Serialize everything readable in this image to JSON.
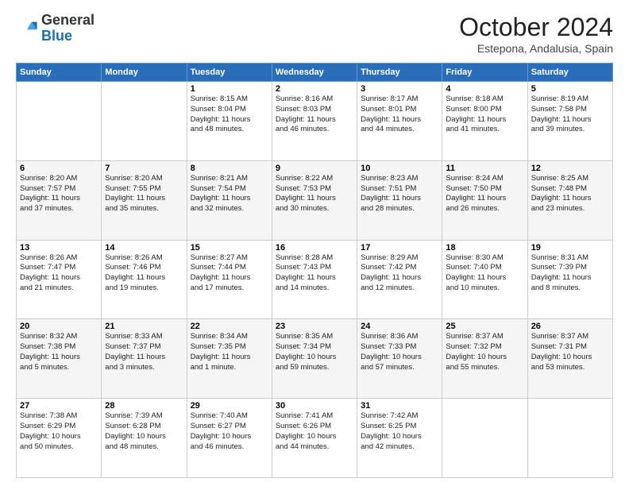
{
  "header": {
    "logo_general": "General",
    "logo_blue": "Blue",
    "month_title": "October 2024",
    "subtitle": "Estepona, Andalusia, Spain"
  },
  "days_of_week": [
    "Sunday",
    "Monday",
    "Tuesday",
    "Wednesday",
    "Thursday",
    "Friday",
    "Saturday"
  ],
  "weeks": [
    [
      {
        "day": "",
        "detail": ""
      },
      {
        "day": "",
        "detail": ""
      },
      {
        "day": "1",
        "detail": "Sunrise: 8:15 AM\nSunset: 8:04 PM\nDaylight: 11 hours\nand 48 minutes."
      },
      {
        "day": "2",
        "detail": "Sunrise: 8:16 AM\nSunset: 8:03 PM\nDaylight: 11 hours\nand 46 minutes."
      },
      {
        "day": "3",
        "detail": "Sunrise: 8:17 AM\nSunset: 8:01 PM\nDaylight: 11 hours\nand 44 minutes."
      },
      {
        "day": "4",
        "detail": "Sunrise: 8:18 AM\nSunset: 8:00 PM\nDaylight: 11 hours\nand 41 minutes."
      },
      {
        "day": "5",
        "detail": "Sunrise: 8:19 AM\nSunset: 7:58 PM\nDaylight: 11 hours\nand 39 minutes."
      }
    ],
    [
      {
        "day": "6",
        "detail": "Sunrise: 8:20 AM\nSunset: 7:57 PM\nDaylight: 11 hours\nand 37 minutes."
      },
      {
        "day": "7",
        "detail": "Sunrise: 8:20 AM\nSunset: 7:55 PM\nDaylight: 11 hours\nand 35 minutes."
      },
      {
        "day": "8",
        "detail": "Sunrise: 8:21 AM\nSunset: 7:54 PM\nDaylight: 11 hours\nand 32 minutes."
      },
      {
        "day": "9",
        "detail": "Sunrise: 8:22 AM\nSunset: 7:53 PM\nDaylight: 11 hours\nand 30 minutes."
      },
      {
        "day": "10",
        "detail": "Sunrise: 8:23 AM\nSunset: 7:51 PM\nDaylight: 11 hours\nand 28 minutes."
      },
      {
        "day": "11",
        "detail": "Sunrise: 8:24 AM\nSunset: 7:50 PM\nDaylight: 11 hours\nand 26 minutes."
      },
      {
        "day": "12",
        "detail": "Sunrise: 8:25 AM\nSunset: 7:48 PM\nDaylight: 11 hours\nand 23 minutes."
      }
    ],
    [
      {
        "day": "13",
        "detail": "Sunrise: 8:26 AM\nSunset: 7:47 PM\nDaylight: 11 hours\nand 21 minutes."
      },
      {
        "day": "14",
        "detail": "Sunrise: 8:26 AM\nSunset: 7:46 PM\nDaylight: 11 hours\nand 19 minutes."
      },
      {
        "day": "15",
        "detail": "Sunrise: 8:27 AM\nSunset: 7:44 PM\nDaylight: 11 hours\nand 17 minutes."
      },
      {
        "day": "16",
        "detail": "Sunrise: 8:28 AM\nSunset: 7:43 PM\nDaylight: 11 hours\nand 14 minutes."
      },
      {
        "day": "17",
        "detail": "Sunrise: 8:29 AM\nSunset: 7:42 PM\nDaylight: 11 hours\nand 12 minutes."
      },
      {
        "day": "18",
        "detail": "Sunrise: 8:30 AM\nSunset: 7:40 PM\nDaylight: 11 hours\nand 10 minutes."
      },
      {
        "day": "19",
        "detail": "Sunrise: 8:31 AM\nSunset: 7:39 PM\nDaylight: 11 hours\nand 8 minutes."
      }
    ],
    [
      {
        "day": "20",
        "detail": "Sunrise: 8:32 AM\nSunset: 7:38 PM\nDaylight: 11 hours\nand 5 minutes."
      },
      {
        "day": "21",
        "detail": "Sunrise: 8:33 AM\nSunset: 7:37 PM\nDaylight: 11 hours\nand 3 minutes."
      },
      {
        "day": "22",
        "detail": "Sunrise: 8:34 AM\nSunset: 7:35 PM\nDaylight: 11 hours\nand 1 minute."
      },
      {
        "day": "23",
        "detail": "Sunrise: 8:35 AM\nSunset: 7:34 PM\nDaylight: 10 hours\nand 59 minutes."
      },
      {
        "day": "24",
        "detail": "Sunrise: 8:36 AM\nSunset: 7:33 PM\nDaylight: 10 hours\nand 57 minutes."
      },
      {
        "day": "25",
        "detail": "Sunrise: 8:37 AM\nSunset: 7:32 PM\nDaylight: 10 hours\nand 55 minutes."
      },
      {
        "day": "26",
        "detail": "Sunrise: 8:37 AM\nSunset: 7:31 PM\nDaylight: 10 hours\nand 53 minutes."
      }
    ],
    [
      {
        "day": "27",
        "detail": "Sunrise: 7:38 AM\nSunset: 6:29 PM\nDaylight: 10 hours\nand 50 minutes."
      },
      {
        "day": "28",
        "detail": "Sunrise: 7:39 AM\nSunset: 6:28 PM\nDaylight: 10 hours\nand 48 minutes."
      },
      {
        "day": "29",
        "detail": "Sunrise: 7:40 AM\nSunset: 6:27 PM\nDaylight: 10 hours\nand 46 minutes."
      },
      {
        "day": "30",
        "detail": "Sunrise: 7:41 AM\nSunset: 6:26 PM\nDaylight: 10 hours\nand 44 minutes."
      },
      {
        "day": "31",
        "detail": "Sunrise: 7:42 AM\nSunset: 6:25 PM\nDaylight: 10 hours\nand 42 minutes."
      },
      {
        "day": "",
        "detail": ""
      },
      {
        "day": "",
        "detail": ""
      }
    ]
  ]
}
